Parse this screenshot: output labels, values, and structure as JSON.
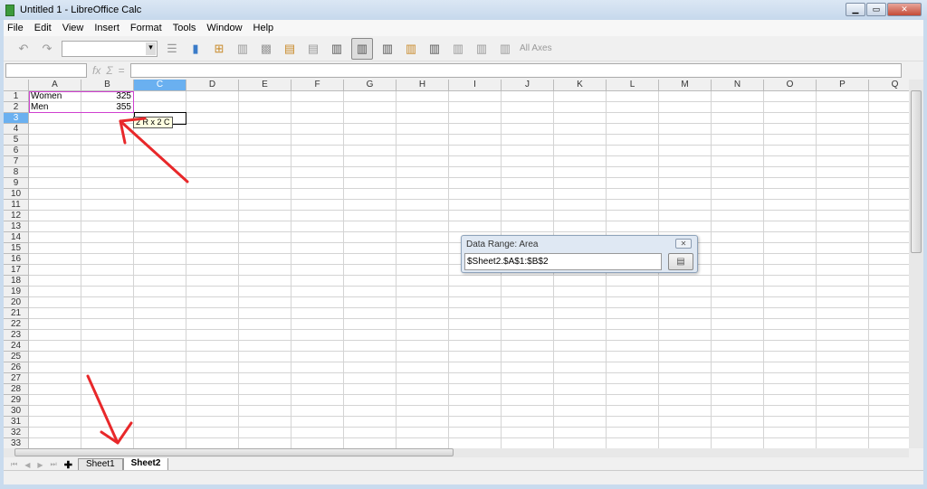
{
  "window": {
    "title": "Untitled 1 - LibreOffice Calc"
  },
  "menu": [
    "File",
    "Edit",
    "View",
    "Insert",
    "Format",
    "Tools",
    "Window",
    "Help"
  ],
  "toolbar": {
    "all_axes_label": "All Axes"
  },
  "columns": [
    "A",
    "B",
    "C",
    "D",
    "E",
    "F",
    "G",
    "H",
    "I",
    "J",
    "K",
    "L",
    "M",
    "N",
    "O",
    "P",
    "Q"
  ],
  "selected_column": "C",
  "selected_row": 3,
  "row_count": 33,
  "cells": {
    "A1": "Women",
    "B1": "325",
    "A2": "Men",
    "B2": "355"
  },
  "tooltip": "2 R x 2 C",
  "dialog": {
    "title": "Data Range: Area",
    "value": "$Sheet2.$A$1:$B$2",
    "close_icon": "close-icon",
    "shrink_icon": "expand-icon"
  },
  "sheets": [
    {
      "label": "Sheet1"
    },
    {
      "label": "Sheet2",
      "active": true
    }
  ],
  "annotation_color": "#e8282a"
}
